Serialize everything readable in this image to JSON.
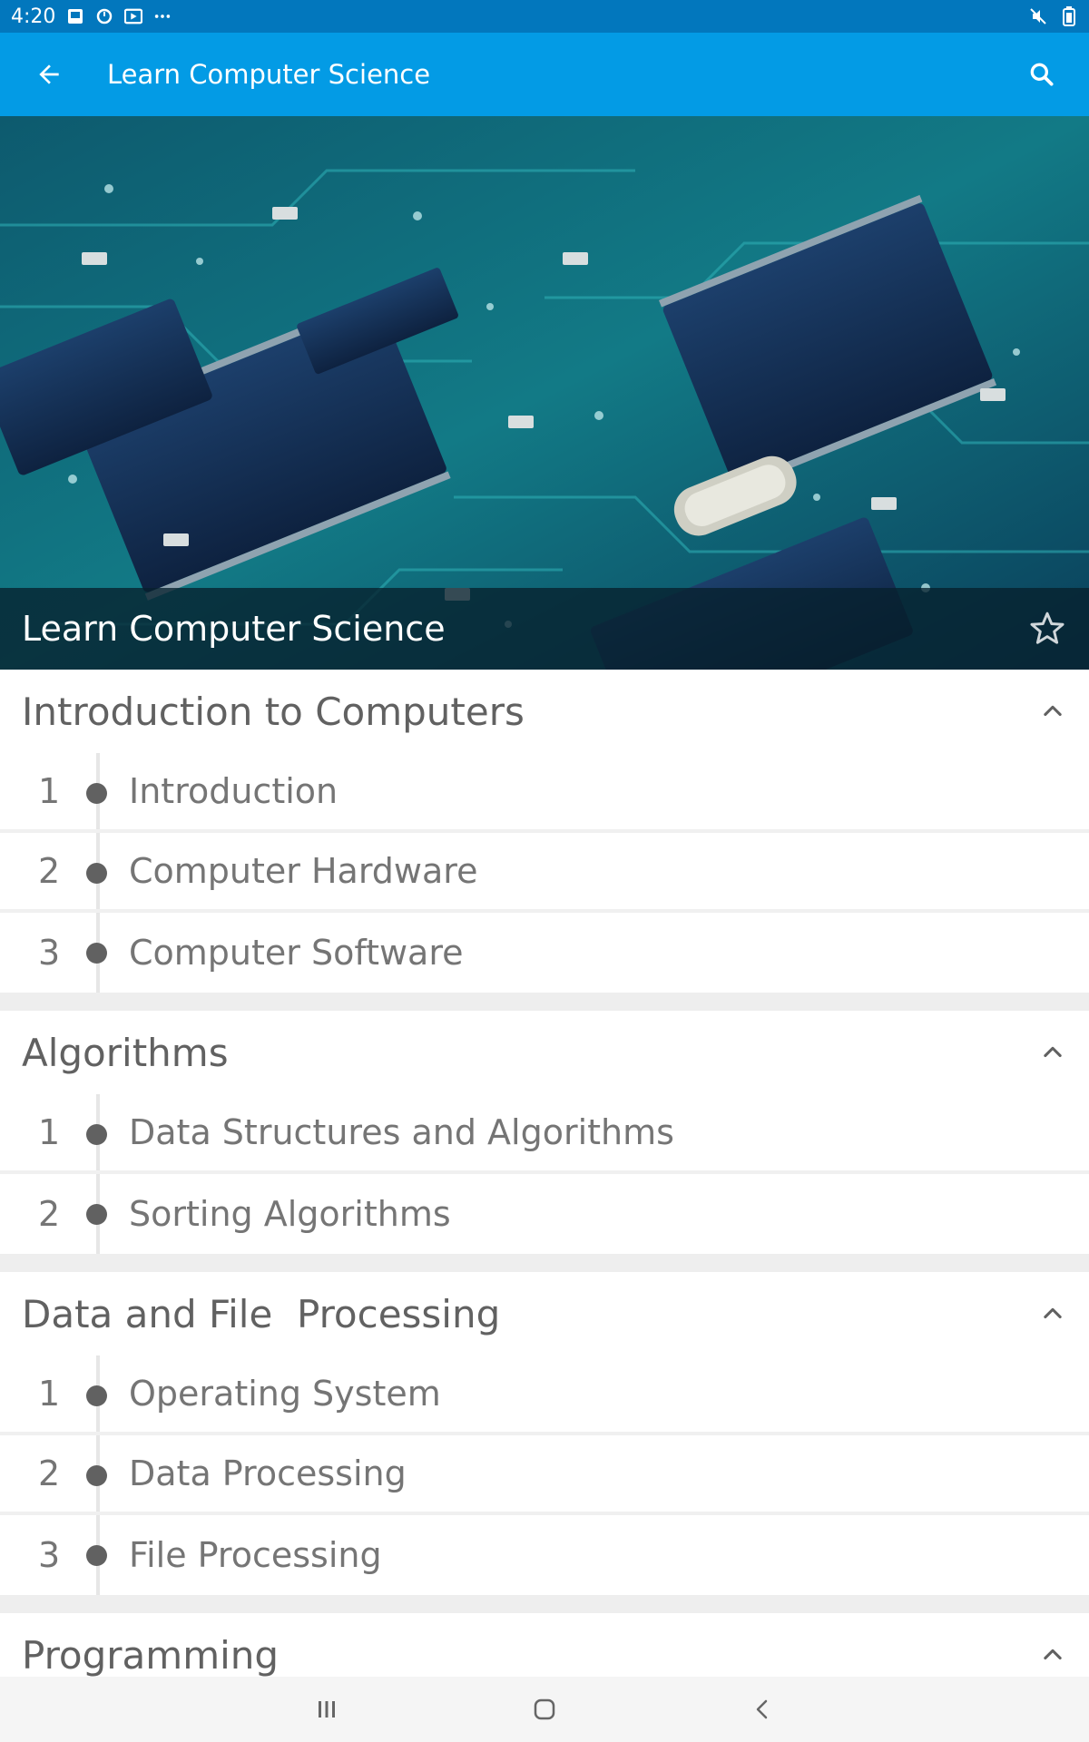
{
  "status_bar": {
    "time": "4:20",
    "left_icons": [
      "image-icon",
      "sync-icon",
      "media-icon",
      "more-dots-icon"
    ],
    "right_icons": [
      "mute-icon",
      "battery-icon"
    ]
  },
  "app_bar": {
    "title": "Learn Computer Science",
    "back_icon": "arrow-left-icon",
    "search_icon": "search-icon",
    "color": "#039be5"
  },
  "hero": {
    "title": "Learn Computer Science",
    "star_icon": "star-outline-icon",
    "image": "circuit-board-photo"
  },
  "sections": [
    {
      "title": "Introduction to Computers",
      "expanded": true,
      "items": [
        {
          "num": "1",
          "label": "Introduction"
        },
        {
          "num": "2",
          "label": "Computer Hardware"
        },
        {
          "num": "3",
          "label": "Computer Software"
        }
      ]
    },
    {
      "title": "Algorithms",
      "expanded": true,
      "items": [
        {
          "num": "1",
          "label": "Data Structures and Algorithms"
        },
        {
          "num": "2",
          "label": "Sorting Algorithms"
        }
      ]
    },
    {
      "title": "Data and File  Processing",
      "expanded": true,
      "items": [
        {
          "num": "1",
          "label": "Operating System"
        },
        {
          "num": "2",
          "label": "Data Processing"
        },
        {
          "num": "3",
          "label": "File Processing"
        }
      ]
    },
    {
      "title": "Programming",
      "expanded": true,
      "items": []
    }
  ],
  "nav_bar": {
    "buttons": [
      "recents-icon",
      "home-icon",
      "back-icon"
    ]
  }
}
